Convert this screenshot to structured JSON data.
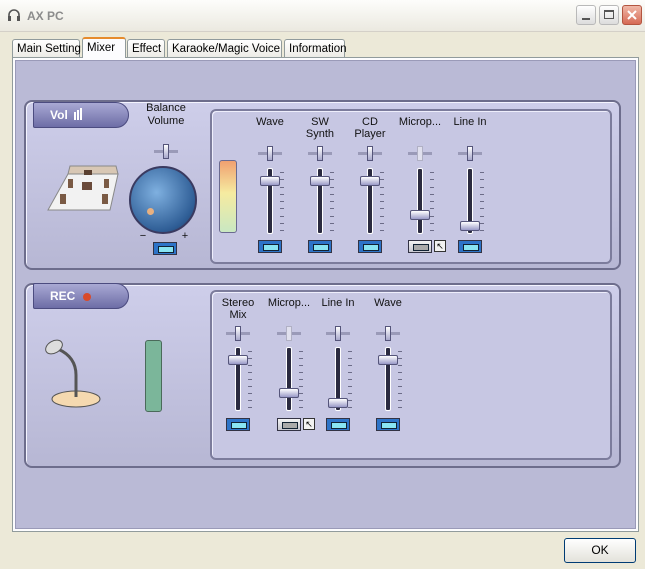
{
  "window": {
    "title": "AX PC"
  },
  "icons": {
    "title": "headphones-icon",
    "minimize": "minimize-icon",
    "maximize": "maximize-icon",
    "close": "close-icon",
    "speaker_room": "speaker-room-icon",
    "microphone": "microphone-icon",
    "arrow": "arrow-cursor-icon"
  },
  "tabs": [
    {
      "label": "Main Setting"
    },
    {
      "label": "Mixer",
      "active": true
    },
    {
      "label": "Effect"
    },
    {
      "label": "Karaoke/Magic Voice"
    },
    {
      "label": "Information"
    }
  ],
  "vol": {
    "badge": "Vol",
    "balance_label_1": "Balance",
    "balance_label_2": "Volume",
    "minus": "−",
    "plus": "+",
    "channels": [
      {
        "line1": "Wave",
        "line2": "",
        "level": 0.85,
        "enabled": true
      },
      {
        "line1": "SW",
        "line2": "Synth",
        "level": 0.85,
        "enabled": true
      },
      {
        "line1": "CD",
        "line2": "Player",
        "level": 0.85,
        "enabled": true
      },
      {
        "line1": "Microp...",
        "line2": "",
        "level": 0.25,
        "enabled": false
      },
      {
        "line1": "Line In",
        "line2": "",
        "level": 0.05,
        "enabled": true
      }
    ]
  },
  "rec": {
    "badge": "REC",
    "record_dot_color": "#d94a2a",
    "channels": [
      {
        "line1": "Stereo",
        "line2": "Mix",
        "level": 0.85,
        "enabled": true
      },
      {
        "line1": "Microp...",
        "line2": "",
        "level": 0.25,
        "enabled": false
      },
      {
        "line1": "Line In",
        "line2": "",
        "level": 0.05,
        "enabled": true
      },
      {
        "line1": "Wave",
        "line2": "",
        "level": 0.85,
        "enabled": true
      }
    ]
  },
  "buttons": {
    "ok": "OK"
  },
  "colors": {
    "accent_tab": "#e68b2c",
    "panel": "#babad6",
    "knob": "#2f5e96"
  }
}
